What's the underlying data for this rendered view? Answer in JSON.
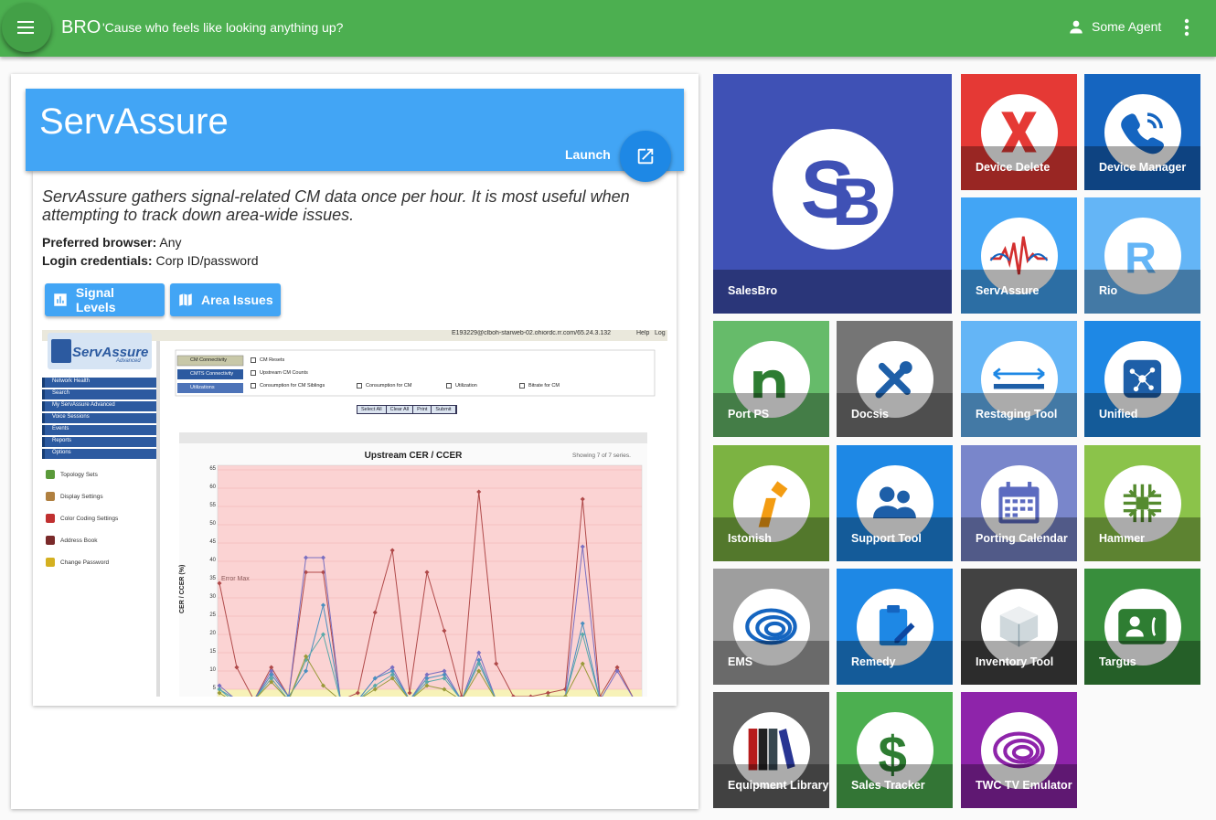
{
  "app": {
    "name": "BRO",
    "tagline": "'Cause who feels like looking anything up?",
    "user": "Some Agent"
  },
  "detail": {
    "title": "ServAssure",
    "launch_label": "Launch",
    "description": "ServAssure gathers signal-related CM data once per hour. It is most useful when attempting to track down area-wide issues.",
    "browser_label": "Preferred browser:",
    "browser_value": "Any",
    "login_label": "Login credentials:",
    "login_value": "Corp ID/password",
    "buttons": [
      "Signal Levels",
      "Area Issues"
    ]
  },
  "screenshot": {
    "user_line": "E193229@clboh-starweb-02.ohiordc.rr.com/65.24.3.132",
    "help": "Help",
    "logout": "Log",
    "logo": "ServAssure",
    "logo_sub": "Advanced",
    "nav": [
      "Network Health",
      "Search",
      "My ServAssure Advanced",
      "Voice Sessions",
      "Events",
      "Reports",
      "Options"
    ],
    "options": [
      "Topology Sets",
      "Display Settings",
      "Color Coding Settings",
      "Address Book",
      "Change Password"
    ],
    "tabs": [
      "CM Connectivity",
      "CMTS Connectivity",
      "Utilizations"
    ],
    "checks": [
      "CM Resets",
      "Upstream CM Counts",
      "Consumption for CM Siblings",
      "Consumption for CM",
      "Utilization",
      "Bitrate for CM"
    ],
    "actions": [
      "Select All",
      "Clear All",
      "Print",
      "Submit"
    ],
    "chart_title": "Upstream CER / CCER",
    "showing": "Showing 7 of 7 series.",
    "ylabel": "CER / CCER (%)",
    "annotation": "Error Max"
  },
  "chart_data": {
    "type": "line",
    "title": "Upstream CER / CCER",
    "ylabel": "CER / CCER (%)",
    "ylim": [
      0,
      65
    ],
    "yticks": [
      "65",
      "60",
      "55",
      "50",
      "45",
      "40",
      "35",
      "30",
      "25",
      "20",
      "15",
      "10",
      "5"
    ],
    "series": [
      {
        "color": "#b04a4a",
        "values": [
          34,
          11,
          2,
          11,
          3,
          37,
          37,
          2,
          4,
          26,
          43,
          4,
          37,
          21,
          3,
          59,
          12,
          3,
          3,
          4,
          5,
          57,
          3,
          11,
          2
        ]
      },
      {
        "color": "#7a6fc0",
        "values": [
          6,
          2,
          2,
          10,
          3,
          41,
          41,
          2,
          2,
          8,
          11,
          2,
          9,
          10,
          2,
          15,
          2,
          2,
          2,
          3,
          3,
          44,
          2,
          10,
          2
        ]
      },
      {
        "color": "#4a8fbf",
        "values": [
          5,
          2,
          2,
          9,
          3,
          10,
          28,
          2,
          2,
          8,
          10,
          2,
          8,
          9,
          2,
          13,
          2,
          2,
          2,
          3,
          3,
          23,
          2,
          2,
          2
        ]
      },
      {
        "color": "#5aa9a9",
        "values": [
          5,
          1,
          2,
          8,
          2,
          13,
          20,
          2,
          2,
          6,
          9,
          2,
          7,
          8,
          2,
          12,
          2,
          2,
          2,
          3,
          3,
          20,
          2,
          2,
          2
        ]
      },
      {
        "color": "#9a9a3a",
        "values": [
          4,
          1,
          2,
          7,
          2,
          14,
          6,
          2,
          2,
          5,
          8,
          2,
          6,
          5,
          2,
          10,
          2,
          2,
          2,
          3,
          3,
          12,
          2,
          2,
          2
        ]
      }
    ]
  },
  "tiles": [
    {
      "label": "SalesBro",
      "bg": "#3f51b5",
      "icon": "salesbro-logo-icon"
    },
    {
      "label": "Device Delete",
      "bg": "#e53935",
      "icon": "x-mark-icon"
    },
    {
      "label": "Device Manager",
      "bg": "#1565c0",
      "icon": "phone-icon"
    },
    {
      "label": "ServAssure",
      "bg": "#42a5f5",
      "icon": "signal-wave-icon"
    },
    {
      "label": "Rio",
      "bg": "#64b5f6",
      "icon": "letter-r-icon"
    },
    {
      "label": "Port PS",
      "bg": "#66bb6a",
      "icon": "letter-n-icon"
    },
    {
      "label": "Docsis",
      "bg": "#757575",
      "icon": "tools-icon"
    },
    {
      "label": "Restaging Tool",
      "bg": "#64b5f6",
      "icon": "arrows-icon"
    },
    {
      "label": "Unified",
      "bg": "#1e88e5",
      "icon": "network-icon"
    },
    {
      "label": "Istonish",
      "bg": "#7cb342",
      "icon": "info-i-icon"
    },
    {
      "label": "Support Tool",
      "bg": "#1e88e5",
      "icon": "people-icon"
    },
    {
      "label": "Porting Calendar",
      "bg": "#7986cb",
      "icon": "calendar-icon"
    },
    {
      "label": "Hammer",
      "bg": "#8bc34a",
      "icon": "chip-icon"
    },
    {
      "label": "EMS",
      "bg": "#9e9e9e",
      "icon": "twc-swirl-icon"
    },
    {
      "label": "Remedy",
      "bg": "#1e88e5",
      "icon": "clipboard-icon"
    },
    {
      "label": "Inventory Tool",
      "bg": "#424242",
      "icon": "box-icon"
    },
    {
      "label": "Targus",
      "bg": "#388e3c",
      "icon": "contact-phone-icon"
    },
    {
      "label": "Equipment Library",
      "bg": "#616161",
      "icon": "books-icon"
    },
    {
      "label": "Sales Tracker",
      "bg": "#4caf50",
      "icon": "dollar-icon"
    },
    {
      "label": "TWC TV Emulator",
      "bg": "#8e24aa",
      "icon": "twc-swirl-icon"
    }
  ]
}
